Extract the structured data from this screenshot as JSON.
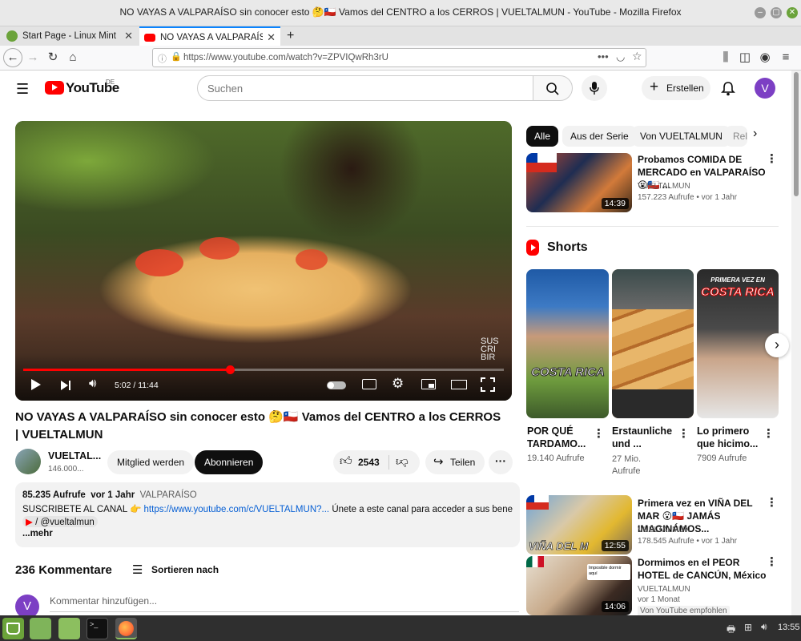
{
  "window": {
    "title": "NO VAYAS A VALPARAÍSO sin conocer esto 🤔🇨🇱 Vamos del CENTRO a los CERROS | VUELTALMUN - YouTube - Mozilla Firefox"
  },
  "tabs": [
    {
      "label": "Start Page - Linux Mint"
    },
    {
      "label": "NO VAYAS A VALPARAÍSO sin conocer esto"
    }
  ],
  "nav": {
    "url": "https://www.youtube.com/watch?v=ZPVIQwRh3rU"
  },
  "yt": {
    "logo_text": "YouTube",
    "region": "DE",
    "search_placeholder": "Suchen",
    "create_label": "Erstellen",
    "avatar_letter": "V"
  },
  "player": {
    "time": "5:02 / 11:44",
    "progress": 0.43,
    "watermark": "SUS CRI BIR"
  },
  "video": {
    "title": "NO VAYAS A VALPARAÍSO sin conocer esto 🤔🇨🇱 Vamos del CENTRO a los CERROS | VUELTALMUN",
    "channel": "VUELTAL...",
    "subscribers": "146.000...",
    "join_label": "Mitglied werden",
    "subscribe_label": "Abonnieren",
    "likes": "2543",
    "share_label": "Teilen"
  },
  "description": {
    "views": "85.235 Aufrufe",
    "date": "vor 1 Jahr",
    "tag": "VALPARAÍSO",
    "line1_text": "SUSCRIBETE AL CANAL 👉",
    "line1_link": "https://www.youtube.com/c/VUELTALMUN?...",
    "line1_rest": "Únete a este canal para acceder a sus beneficios:",
    "line2": "/ @vueltalmun",
    "more": "...mehr"
  },
  "comments": {
    "count_label": "236 Kommentare",
    "sort_label": "Sortieren nach",
    "placeholder": "Kommentar hinzufügen...",
    "avatar_letter": "V"
  },
  "filters": [
    "Alle",
    "Aus der Serie",
    "Von VUELTALMUN",
    "Rel"
  ],
  "recommended": [
    {
      "title": "Probamos COMIDA DE MERCADO en VALPARAÍSO😮🇨🇱 ...",
      "channel": "VUELTALMUN",
      "meta": "157.223 Aufrufe • vor 1 Jahr",
      "duration": "14:39"
    },
    {
      "title": "Primera vez en VIÑA DEL MAR 😮🇨🇱 JAMÁS IMAGINÁMOS...",
      "channel": "VUELTALMUN",
      "meta": "178.545 Aufrufe • vor 1 Jahr",
      "duration": "12:55",
      "overlay": "VIÑA DEL M"
    },
    {
      "title": "Dormimos en el PEOR HOTEL de CANCÚN, México",
      "channel": "VUELTALMUN",
      "meta": "vor 1 Monat",
      "badge": "Von YouTube empfohlen",
      "duration": "14:06",
      "overlay": "Imposible dormir aquí"
    }
  ],
  "shorts": {
    "header": "Shorts",
    "items": [
      {
        "title": "POR QUÉ TARDAMO...",
        "views": "19.140 Aufrufe",
        "overlay": "COSTA RICA"
      },
      {
        "title": "Erstaunliche und ...",
        "views": "27 Mio. Aufrufe",
        "overlay": ""
      },
      {
        "title": "Lo primero que hicimo...",
        "views": "7909 Aufrufe",
        "overlay": "COSTA RICA",
        "overlay_top": "PRIMERA VEZ EN"
      }
    ]
  },
  "taskbar": {
    "clock": "13:55"
  }
}
